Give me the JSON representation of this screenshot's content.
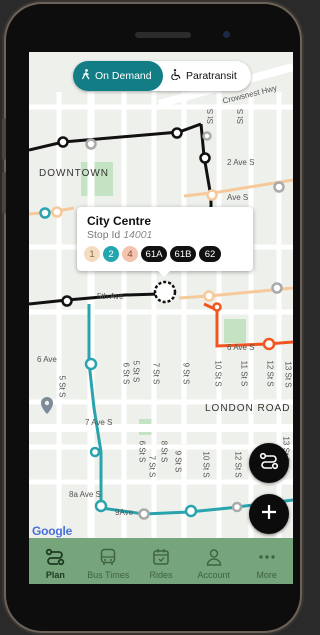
{
  "mode_toggle": {
    "on_demand_label": "On Demand",
    "paratransit_label": "Paratransit",
    "active": "on_demand"
  },
  "map": {
    "area_labels": {
      "downtown": "DOWNTOWN",
      "london_road": "LONDON ROAD"
    },
    "street_labels": {
      "crowsnest": "Crowsnest Hwy",
      "ave2s": "2 Ave S",
      "ave3s_right": "Ave S",
      "ave6": "6 Ave",
      "ave6s": "6 Ave S",
      "ave7s": "7 Ave S",
      "ave8": "8a Ave S",
      "ave9": "9Ave",
      "st5s": "5 St S",
      "st6s": "6 St S",
      "st7s": "7 St S",
      "st9s": "9 St S",
      "st10s": "10 St S",
      "st11s": "11 St S",
      "st12s": "12 St S",
      "st13s": "13 St S",
      "st13s_b": "13 St S",
      "st9s_b": "9 St S",
      "st10s_b": "10 St S",
      "st12s_b": "12 St S",
      "st5s_b": "5 St S",
      "st6s_b": "6 St S",
      "st7s_b": "7 St S",
      "st8s_b": "8 St S",
      "st_top": "St S",
      "st_top2": "St S",
      "ave5": "5th Ave"
    },
    "attribution": "Google"
  },
  "stop_popup": {
    "name": "City Centre",
    "stop_label": "Stop Id",
    "stop_id": "14001",
    "routes": [
      {
        "label": "1",
        "bg": "#f4dcc0",
        "fg": "#8a6a3a"
      },
      {
        "label": "2",
        "bg": "#24a6b0",
        "fg": "#ffffff"
      },
      {
        "label": "4",
        "bg": "#f4c3b0",
        "fg": "#8a4a34"
      },
      {
        "label": "61A",
        "bg": "#111111",
        "fg": "#ffffff"
      },
      {
        "label": "61B",
        "bg": "#111111",
        "fg": "#ffffff"
      },
      {
        "label": "62",
        "bg": "#111111",
        "fg": "#ffffff"
      }
    ]
  },
  "fabs": {
    "trip_planner_icon": "route-icon",
    "add_icon": "plus-icon"
  },
  "bottom_nav": {
    "items": [
      {
        "label": "Plan",
        "icon": "route-icon"
      },
      {
        "label": "Bus Times",
        "icon": "bus-icon"
      },
      {
        "label": "Rides",
        "icon": "calendar-icon"
      },
      {
        "label": "Account",
        "icon": "person-icon"
      },
      {
        "label": "More",
        "icon": "dots-icon"
      }
    ],
    "active": "Plan"
  },
  "colors": {
    "teal": "#137d85",
    "route_teal": "#29a3ad",
    "route_orange": "#f2551e",
    "route_peach": "#f6c99b",
    "nav_green": "#77a57b"
  }
}
